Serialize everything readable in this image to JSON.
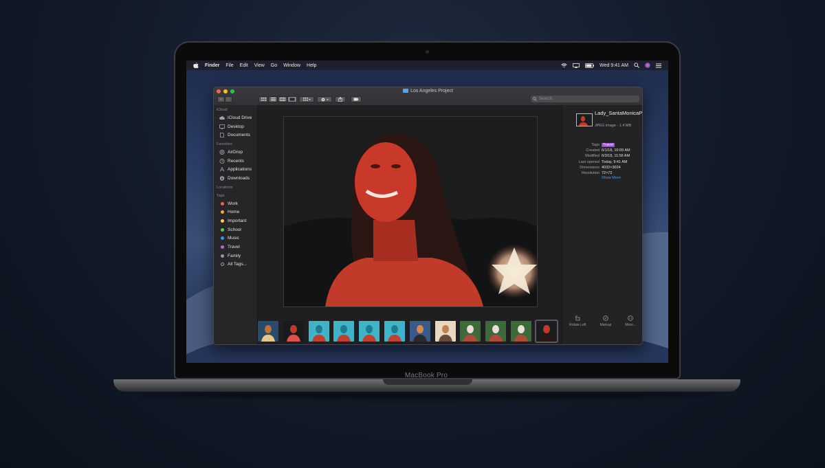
{
  "laptop": {
    "model_label": "MacBook Pro"
  },
  "menubar": {
    "app": "Finder",
    "menus": [
      "File",
      "Edit",
      "View",
      "Go",
      "Window",
      "Help"
    ],
    "clock": "Wed 9:41 AM",
    "status_icons": [
      "wifi-icon",
      "airplay-icon",
      "battery-icon",
      "search-icon",
      "siri-icon",
      "notification-center-icon"
    ]
  },
  "window": {
    "title": "Los Angeles Project",
    "search_placeholder": "Search",
    "toolbar_icons": [
      "back-icon",
      "forward-icon",
      "icon-view-icon",
      "list-view-icon",
      "column-view-icon",
      "gallery-view-icon",
      "group-icon",
      "action-gear-icon",
      "share-icon",
      "tag-icon"
    ]
  },
  "sidebar": {
    "icloud_header": "iCloud",
    "icloud": [
      "iCloud Drive",
      "Desktop",
      "Documents"
    ],
    "favorites_header": "Favorites",
    "favorites": [
      "AirDrop",
      "Recents",
      "Applications",
      "Downloads"
    ],
    "locations_header": "Locations",
    "tags_header": "Tags",
    "tags": [
      {
        "label": "Work",
        "color": "#f0605a"
      },
      {
        "label": "Home",
        "color": "#f5a442"
      },
      {
        "label": "Important",
        "color": "#f5d547"
      },
      {
        "label": "School",
        "color": "#5ccb4e"
      },
      {
        "label": "Music",
        "color": "#4a8ff0"
      },
      {
        "label": "Travel",
        "color": "#b06ad8"
      },
      {
        "label": "Family",
        "color": "#9a9a9e"
      },
      {
        "label": "All Tags...",
        "color": ""
      }
    ]
  },
  "inspector": {
    "file_name": "Lady_SantaMonicaPier.jpeg",
    "file_kind": "JPEG image - 1.4 MB",
    "meta": {
      "tags_label": "Tags",
      "tags_value": "Travel",
      "created_label": "Created",
      "created_value": "6/1/18, 10:09 AM",
      "modified_label": "Modified",
      "modified_value": "6/3/18, 11:56 AM",
      "opened_label": "Last opened",
      "opened_value": "Today, 9:41 AM",
      "dimensions_label": "Dimensions",
      "dimensions_value": "4032×3024",
      "resolution_label": "Resolution",
      "resolution_value": "72×72"
    },
    "show_more": "Show More",
    "actions": [
      "Rotate Left",
      "Markup",
      "More..."
    ]
  },
  "gallery": {
    "thumbnails": [
      "beach-thumb",
      "woman-red-thumb",
      "pool-thumb",
      "pool-thumb",
      "pool-thumb",
      "pool-thumb",
      "sunset-thumb",
      "women-thumb",
      "group-thumb",
      "group-thumb",
      "group-thumb",
      "lady-santamonica-thumb"
    ],
    "selected_index": 11
  }
}
